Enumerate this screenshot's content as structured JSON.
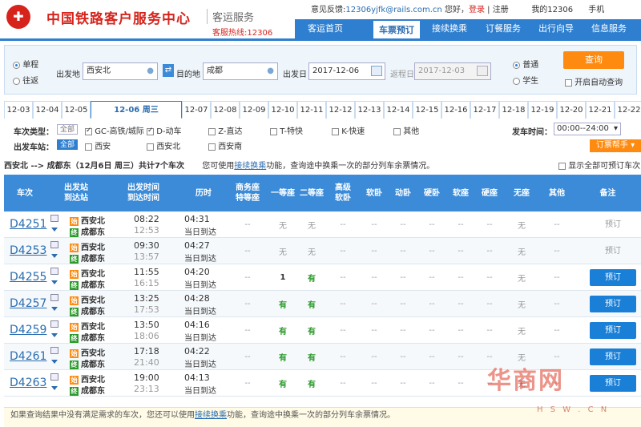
{
  "header": {
    "logo_glyph": "✚",
    "title": "中国铁路客户服务中心",
    "subtitle": "客运服务",
    "hotline": "客服热线:12306",
    "feedback_label": "意见反馈:",
    "feedback_email": "12306yjfk@rails.com.cn",
    "greeting": "您好，",
    "login": "登录",
    "sep": "|",
    "register": "注册",
    "my12306": "我的12306",
    "mobile": "手机"
  },
  "nav": [
    "客运首页",
    "车票预订",
    "接续换乘",
    "订餐服务",
    "出行向导",
    "信息服务"
  ],
  "search": {
    "trip_single": "单程",
    "trip_round": "往返",
    "from_label": "出发地",
    "from_value": "西安北",
    "swap_icon": "⇄",
    "to_label": "目的地",
    "to_value": "成都",
    "date_label": "出发日",
    "date_value": "2017-12-06",
    "return_label": "返程日",
    "return_value": "2017-12-03",
    "type_normal": "普通",
    "type_student": "学生",
    "query": "查询",
    "auto_query": "开启自动查询"
  },
  "date_tabs": [
    "12-03",
    "12-04",
    "12-05",
    "12-06 周三",
    "12-07",
    "12-08",
    "12-09",
    "12-10",
    "12-11",
    "12-12",
    "12-13",
    "12-14",
    "12-15",
    "12-16",
    "12-17",
    "12-18",
    "12-19",
    "12-20",
    "12-21",
    "12-22"
  ],
  "filters": {
    "type_label": "车次类型：",
    "all": "全部",
    "types": [
      "GC-高铁/城际",
      "D-动车",
      "Z-直达",
      "T-特快",
      "K-快速",
      "其他"
    ],
    "station_label": "出发车站：",
    "stations": [
      "西安",
      "西安北",
      "西安南"
    ],
    "time_label": "发车时间：",
    "time_value": "00:00--24:00",
    "helper": "订票帮手"
  },
  "route": {
    "text": "西安北 --> 成都东（12月6日 周三）共计7个车次",
    "tip1": "您可使用",
    "tip_link": "接续换乘",
    "tip2": "功能，查询途中换乘一次的部分列车余票情况。",
    "show_all": "显示全部可预订车次"
  },
  "table": {
    "headers": [
      "车次",
      "出发站\n到达站",
      "出发时间\n到达时间",
      "历时",
      "商务座\n特等座",
      "一等座",
      "二等座",
      "高级\n软卧",
      "软卧",
      "动卧",
      "硬卧",
      "软座",
      "硬座",
      "无座",
      "其他",
      "备注"
    ],
    "rows": [
      {
        "no": "D4251",
        "from": "西安北",
        "to": "成都东",
        "dep": "08:22",
        "arr": "12:53",
        "dur": "04:31",
        "day": "当日到达",
        "seats": [
          "--",
          "无",
          "无",
          "--",
          "--",
          "--",
          "--",
          "--",
          "--",
          "无",
          "--"
        ],
        "action": "预订",
        "bookable": false
      },
      {
        "no": "D4253",
        "from": "西安北",
        "to": "成都东",
        "dep": "09:30",
        "arr": "13:57",
        "dur": "04:27",
        "day": "当日到达",
        "seats": [
          "--",
          "无",
          "无",
          "--",
          "--",
          "--",
          "--",
          "--",
          "--",
          "无",
          "--"
        ],
        "action": "预订",
        "bookable": false
      },
      {
        "no": "D4255",
        "from": "西安北",
        "to": "成都东",
        "dep": "11:55",
        "arr": "16:15",
        "dur": "04:20",
        "day": "当日到达",
        "seats": [
          "--",
          "1",
          "有",
          "--",
          "--",
          "--",
          "--",
          "--",
          "--",
          "无",
          "--"
        ],
        "action": "预订",
        "bookable": true
      },
      {
        "no": "D4257",
        "from": "西安北",
        "to": "成都东",
        "dep": "13:25",
        "arr": "17:53",
        "dur": "04:28",
        "day": "当日到达",
        "seats": [
          "--",
          "有",
          "有",
          "--",
          "--",
          "--",
          "--",
          "--",
          "--",
          "无",
          "--"
        ],
        "action": "预订",
        "bookable": true
      },
      {
        "no": "D4259",
        "from": "西安北",
        "to": "成都东",
        "dep": "13:50",
        "arr": "18:06",
        "dur": "04:16",
        "day": "当日到达",
        "seats": [
          "--",
          "有",
          "有",
          "--",
          "--",
          "--",
          "--",
          "--",
          "--",
          "无",
          "--"
        ],
        "action": "预订",
        "bookable": true
      },
      {
        "no": "D4261",
        "from": "西安北",
        "to": "成都东",
        "dep": "17:18",
        "arr": "21:40",
        "dur": "04:22",
        "day": "当日到达",
        "seats": [
          "--",
          "有",
          "有",
          "--",
          "--",
          "--",
          "--",
          "--",
          "--",
          "无",
          "--"
        ],
        "action": "预订",
        "bookable": true
      },
      {
        "no": "D4263",
        "from": "西安北",
        "to": "成都东",
        "dep": "19:00",
        "arr": "23:13",
        "dur": "04:13",
        "day": "当日到达",
        "seats": [
          "--",
          "有",
          "有",
          "--",
          "--",
          "--",
          "--",
          "--",
          "--",
          "无",
          "--"
        ],
        "action": "预订",
        "bookable": true
      }
    ],
    "badge_start": "始",
    "badge_end": "终"
  },
  "footer": {
    "text1": "如果查询结果中没有满足需求的车次，您还可以使用",
    "link": "接续换乘",
    "text2": "功能，查询途中换乘一次的部分列车余票情况。"
  },
  "watermark": {
    "main": "华商网",
    "url": "H S W . C N"
  }
}
